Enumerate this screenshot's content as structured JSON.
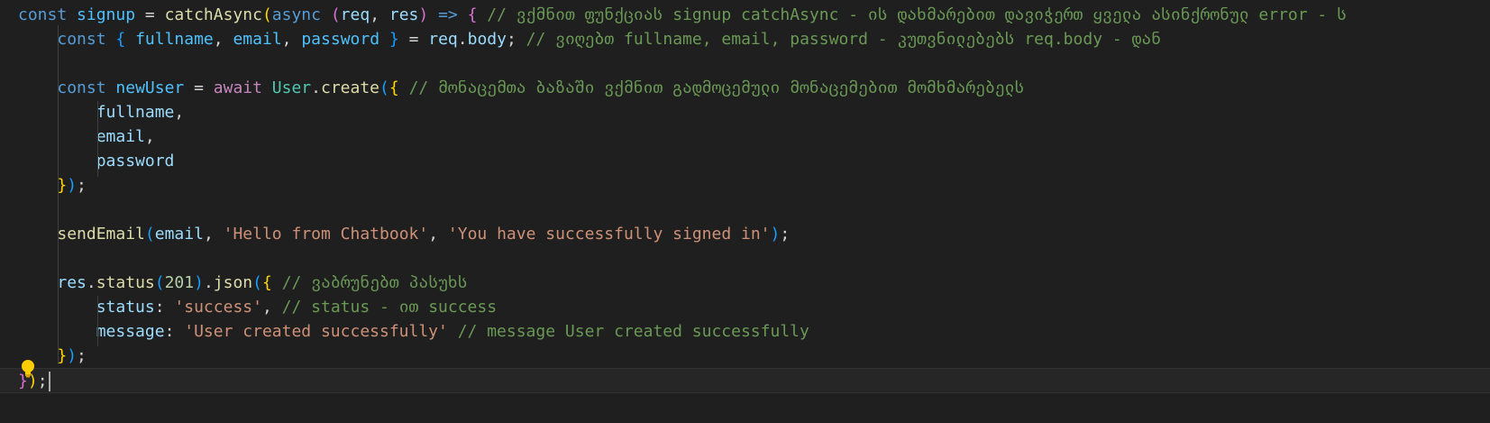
{
  "editor": {
    "lines": [
      [
        {
          "t": "const",
          "c": "keyword"
        },
        {
          "t": " ",
          "c": "punct"
        },
        {
          "t": "signup",
          "c": "constant"
        },
        {
          "t": " = ",
          "c": "punct"
        },
        {
          "t": "catchAsync",
          "c": "function"
        },
        {
          "t": "(",
          "c": "brace1"
        },
        {
          "t": "async",
          "c": "keyword"
        },
        {
          "t": " ",
          "c": "punct"
        },
        {
          "t": "(",
          "c": "brace2"
        },
        {
          "t": "req",
          "c": "variable"
        },
        {
          "t": ", ",
          "c": "punct"
        },
        {
          "t": "res",
          "c": "variable"
        },
        {
          "t": ")",
          "c": "brace2"
        },
        {
          "t": " ",
          "c": "punct"
        },
        {
          "t": "=>",
          "c": "keyword"
        },
        {
          "t": " ",
          "c": "punct"
        },
        {
          "t": "{",
          "c": "brace2"
        },
        {
          "t": " ",
          "c": "punct"
        },
        {
          "t": "// ვქმნით ფუნქციას signup catchAsync - ის დახმარებით დავიჭერთ ყველა ასინქრონულ error - ს",
          "c": "comment"
        }
      ],
      [
        {
          "t": "    ",
          "c": "punct"
        },
        {
          "t": "const",
          "c": "keyword"
        },
        {
          "t": " ",
          "c": "punct"
        },
        {
          "t": "{",
          "c": "brace3"
        },
        {
          "t": " ",
          "c": "punct"
        },
        {
          "t": "fullname",
          "c": "constant"
        },
        {
          "t": ", ",
          "c": "punct"
        },
        {
          "t": "email",
          "c": "constant"
        },
        {
          "t": ", ",
          "c": "punct"
        },
        {
          "t": "password",
          "c": "constant"
        },
        {
          "t": " ",
          "c": "punct"
        },
        {
          "t": "}",
          "c": "brace3"
        },
        {
          "t": " = ",
          "c": "punct"
        },
        {
          "t": "req",
          "c": "variable"
        },
        {
          "t": ".",
          "c": "punct"
        },
        {
          "t": "body",
          "c": "variable"
        },
        {
          "t": "; ",
          "c": "punct"
        },
        {
          "t": "// ვიღებთ fullname, email, password - კუთვნილებებს req.body - დან",
          "c": "comment"
        }
      ],
      [],
      [
        {
          "t": "    ",
          "c": "punct"
        },
        {
          "t": "const",
          "c": "keyword"
        },
        {
          "t": " ",
          "c": "punct"
        },
        {
          "t": "newUser",
          "c": "constant"
        },
        {
          "t": " = ",
          "c": "punct"
        },
        {
          "t": "await",
          "c": "control"
        },
        {
          "t": " ",
          "c": "punct"
        },
        {
          "t": "User",
          "c": "class"
        },
        {
          "t": ".",
          "c": "punct"
        },
        {
          "t": "create",
          "c": "function"
        },
        {
          "t": "(",
          "c": "brace3"
        },
        {
          "t": "{",
          "c": "brace1"
        },
        {
          "t": " ",
          "c": "punct"
        },
        {
          "t": "// მონაცემთა ბაზაში ვქმნით გადმოცემული მონაცემებით მომხმარებელს",
          "c": "comment"
        }
      ],
      [
        {
          "t": "        ",
          "c": "punct"
        },
        {
          "t": "fullname",
          "c": "variable"
        },
        {
          "t": ",",
          "c": "punct"
        }
      ],
      [
        {
          "t": "        ",
          "c": "punct"
        },
        {
          "t": "email",
          "c": "variable"
        },
        {
          "t": ",",
          "c": "punct"
        }
      ],
      [
        {
          "t": "        ",
          "c": "punct"
        },
        {
          "t": "password",
          "c": "variable"
        }
      ],
      [
        {
          "t": "    ",
          "c": "punct"
        },
        {
          "t": "}",
          "c": "brace1"
        },
        {
          "t": ")",
          "c": "brace3"
        },
        {
          "t": ";",
          "c": "punct"
        }
      ],
      [],
      [
        {
          "t": "    ",
          "c": "punct"
        },
        {
          "t": "sendEmail",
          "c": "function"
        },
        {
          "t": "(",
          "c": "brace3"
        },
        {
          "t": "email",
          "c": "variable"
        },
        {
          "t": ", ",
          "c": "punct"
        },
        {
          "t": "'Hello from Chatbook'",
          "c": "string"
        },
        {
          "t": ", ",
          "c": "punct"
        },
        {
          "t": "'You have successfully signed in'",
          "c": "string"
        },
        {
          "t": ")",
          "c": "brace3"
        },
        {
          "t": ";",
          "c": "punct"
        }
      ],
      [],
      [
        {
          "t": "    ",
          "c": "punct"
        },
        {
          "t": "res",
          "c": "variable"
        },
        {
          "t": ".",
          "c": "punct"
        },
        {
          "t": "status",
          "c": "function"
        },
        {
          "t": "(",
          "c": "brace3"
        },
        {
          "t": "201",
          "c": "number"
        },
        {
          "t": ")",
          "c": "brace3"
        },
        {
          "t": ".",
          "c": "punct"
        },
        {
          "t": "json",
          "c": "function"
        },
        {
          "t": "(",
          "c": "brace3"
        },
        {
          "t": "{",
          "c": "brace1"
        },
        {
          "t": " ",
          "c": "punct"
        },
        {
          "t": "// ვაბრუნებთ პასუხს",
          "c": "comment"
        }
      ],
      [
        {
          "t": "        ",
          "c": "punct"
        },
        {
          "t": "status",
          "c": "variable"
        },
        {
          "t": ": ",
          "c": "punct"
        },
        {
          "t": "'success'",
          "c": "string"
        },
        {
          "t": ", ",
          "c": "punct"
        },
        {
          "t": "// status - ით success",
          "c": "comment"
        }
      ],
      [
        {
          "t": "        ",
          "c": "punct"
        },
        {
          "t": "message",
          "c": "variable"
        },
        {
          "t": ": ",
          "c": "punct"
        },
        {
          "t": "'User created successfully'",
          "c": "string"
        },
        {
          "t": " ",
          "c": "punct"
        },
        {
          "t": "// message User created successfully",
          "c": "comment"
        }
      ],
      [
        {
          "t": "    ",
          "c": "punct"
        },
        {
          "t": "}",
          "c": "brace1"
        },
        {
          "t": ")",
          "c": "brace3"
        },
        {
          "t": ";",
          "c": "punct"
        }
      ],
      [
        {
          "t": "}",
          "c": "brace2"
        },
        {
          "t": ")",
          "c": "brace1"
        },
        {
          "t": ";",
          "c": "punct"
        }
      ]
    ]
  },
  "colors": {
    "background": "#1f1f1f",
    "keyword": "#569cd6",
    "control": "#c586c0",
    "function": "#dcdcaa",
    "variable": "#9cdcfe",
    "constant": "#4fc1ff",
    "class": "#4ec9b0",
    "string": "#ce9178",
    "number": "#b5cea8",
    "comment": "#6a9955",
    "lightbulb": "#ffcc00"
  },
  "icons": {
    "lightbulb": "lightbulb-icon"
  }
}
